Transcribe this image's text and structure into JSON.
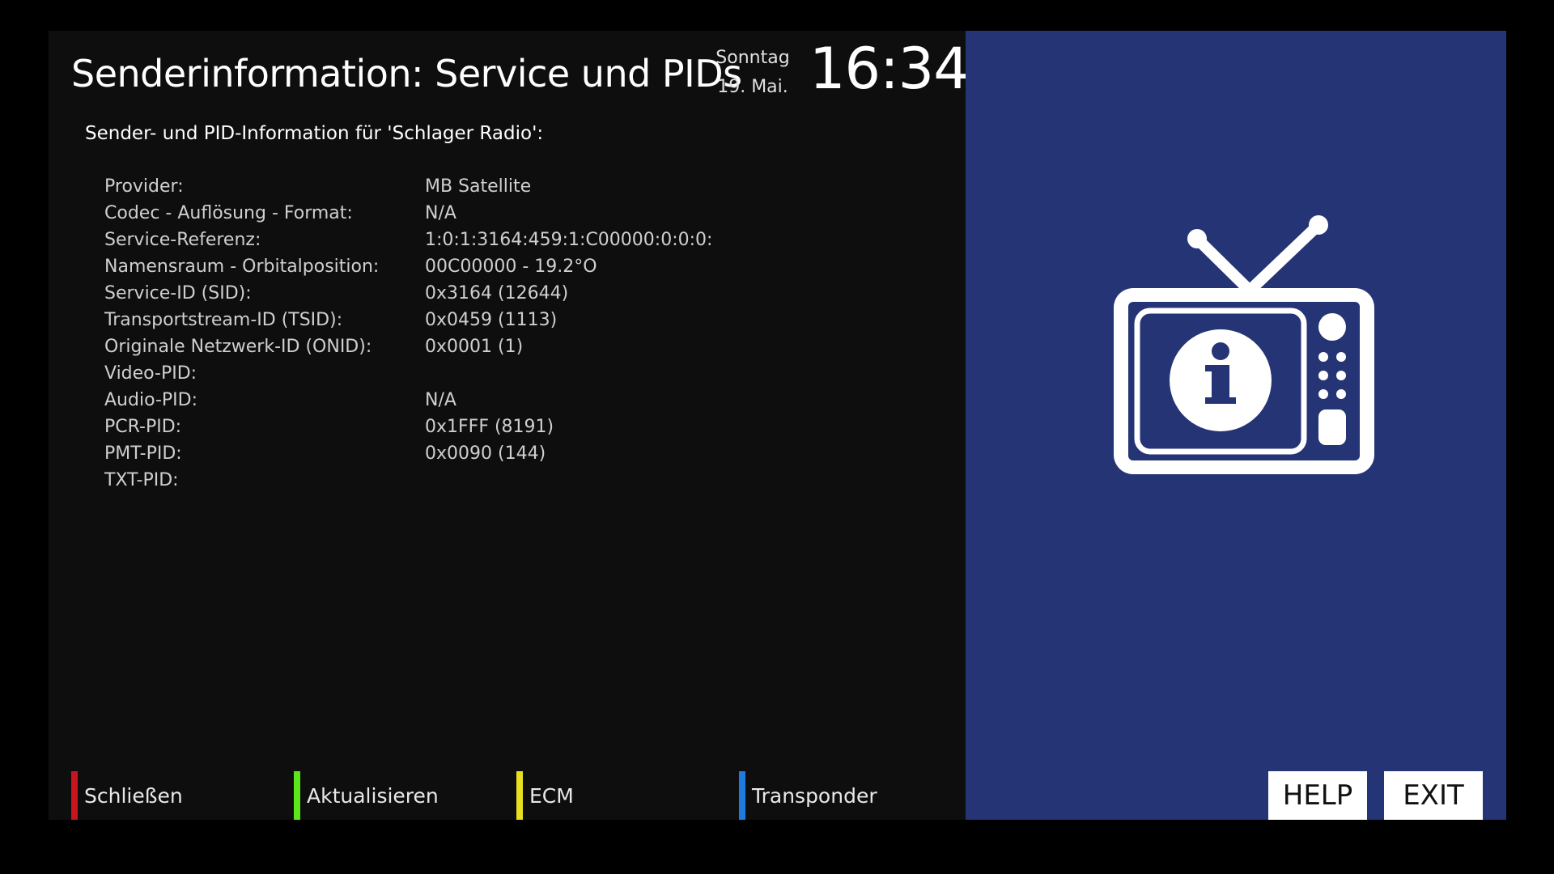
{
  "header": {
    "title": "Senderinformation: Service und PIDs",
    "day": "Sonntag",
    "date": "19. Mai.",
    "time": "16:34"
  },
  "subtitle": "Sender- und PID-Information für 'Schlager Radio':",
  "info": [
    {
      "label": "Provider:",
      "value": "MB Satellite"
    },
    {
      "label": "Codec - Auflösung - Format:",
      "value": "N/A"
    },
    {
      "label": "Service-Referenz:",
      "value": "1:0:1:3164:459:1:C00000:0:0:0:"
    },
    {
      "label": "Namensraum - Orbitalposition:",
      "value": "00C00000  -  19.2°O"
    },
    {
      "label": "Service-ID (SID):",
      "value": "0x3164  (12644)"
    },
    {
      "label": "Transportstream-ID (TSID):",
      "value": "0x0459  (1113)"
    },
    {
      "label": "Originale Netzwerk-ID (ONID):",
      "value": "0x0001  (1)"
    },
    {
      "label": "Video-PID:",
      "value": ""
    },
    {
      "label": "Audio-PID:",
      "value": "N/A"
    },
    {
      "label": "PCR-PID:",
      "value": "0x1FFF  (8191)"
    },
    {
      "label": "PMT-PID:",
      "value": "0x0090  (144)"
    },
    {
      "label": "TXT-PID:",
      "value": ""
    }
  ],
  "buttons": {
    "red": "Schließen",
    "green": "Aktualisieren",
    "yellow": "ECM",
    "blue": "Transponder",
    "help": "HELP",
    "exit": "EXIT"
  },
  "colors": {
    "red": "#c8141c",
    "green": "#5be61a",
    "yellow": "#e6e020",
    "blue": "#1e7be0",
    "panel": "#253474"
  },
  "icon": "tv-info-icon"
}
